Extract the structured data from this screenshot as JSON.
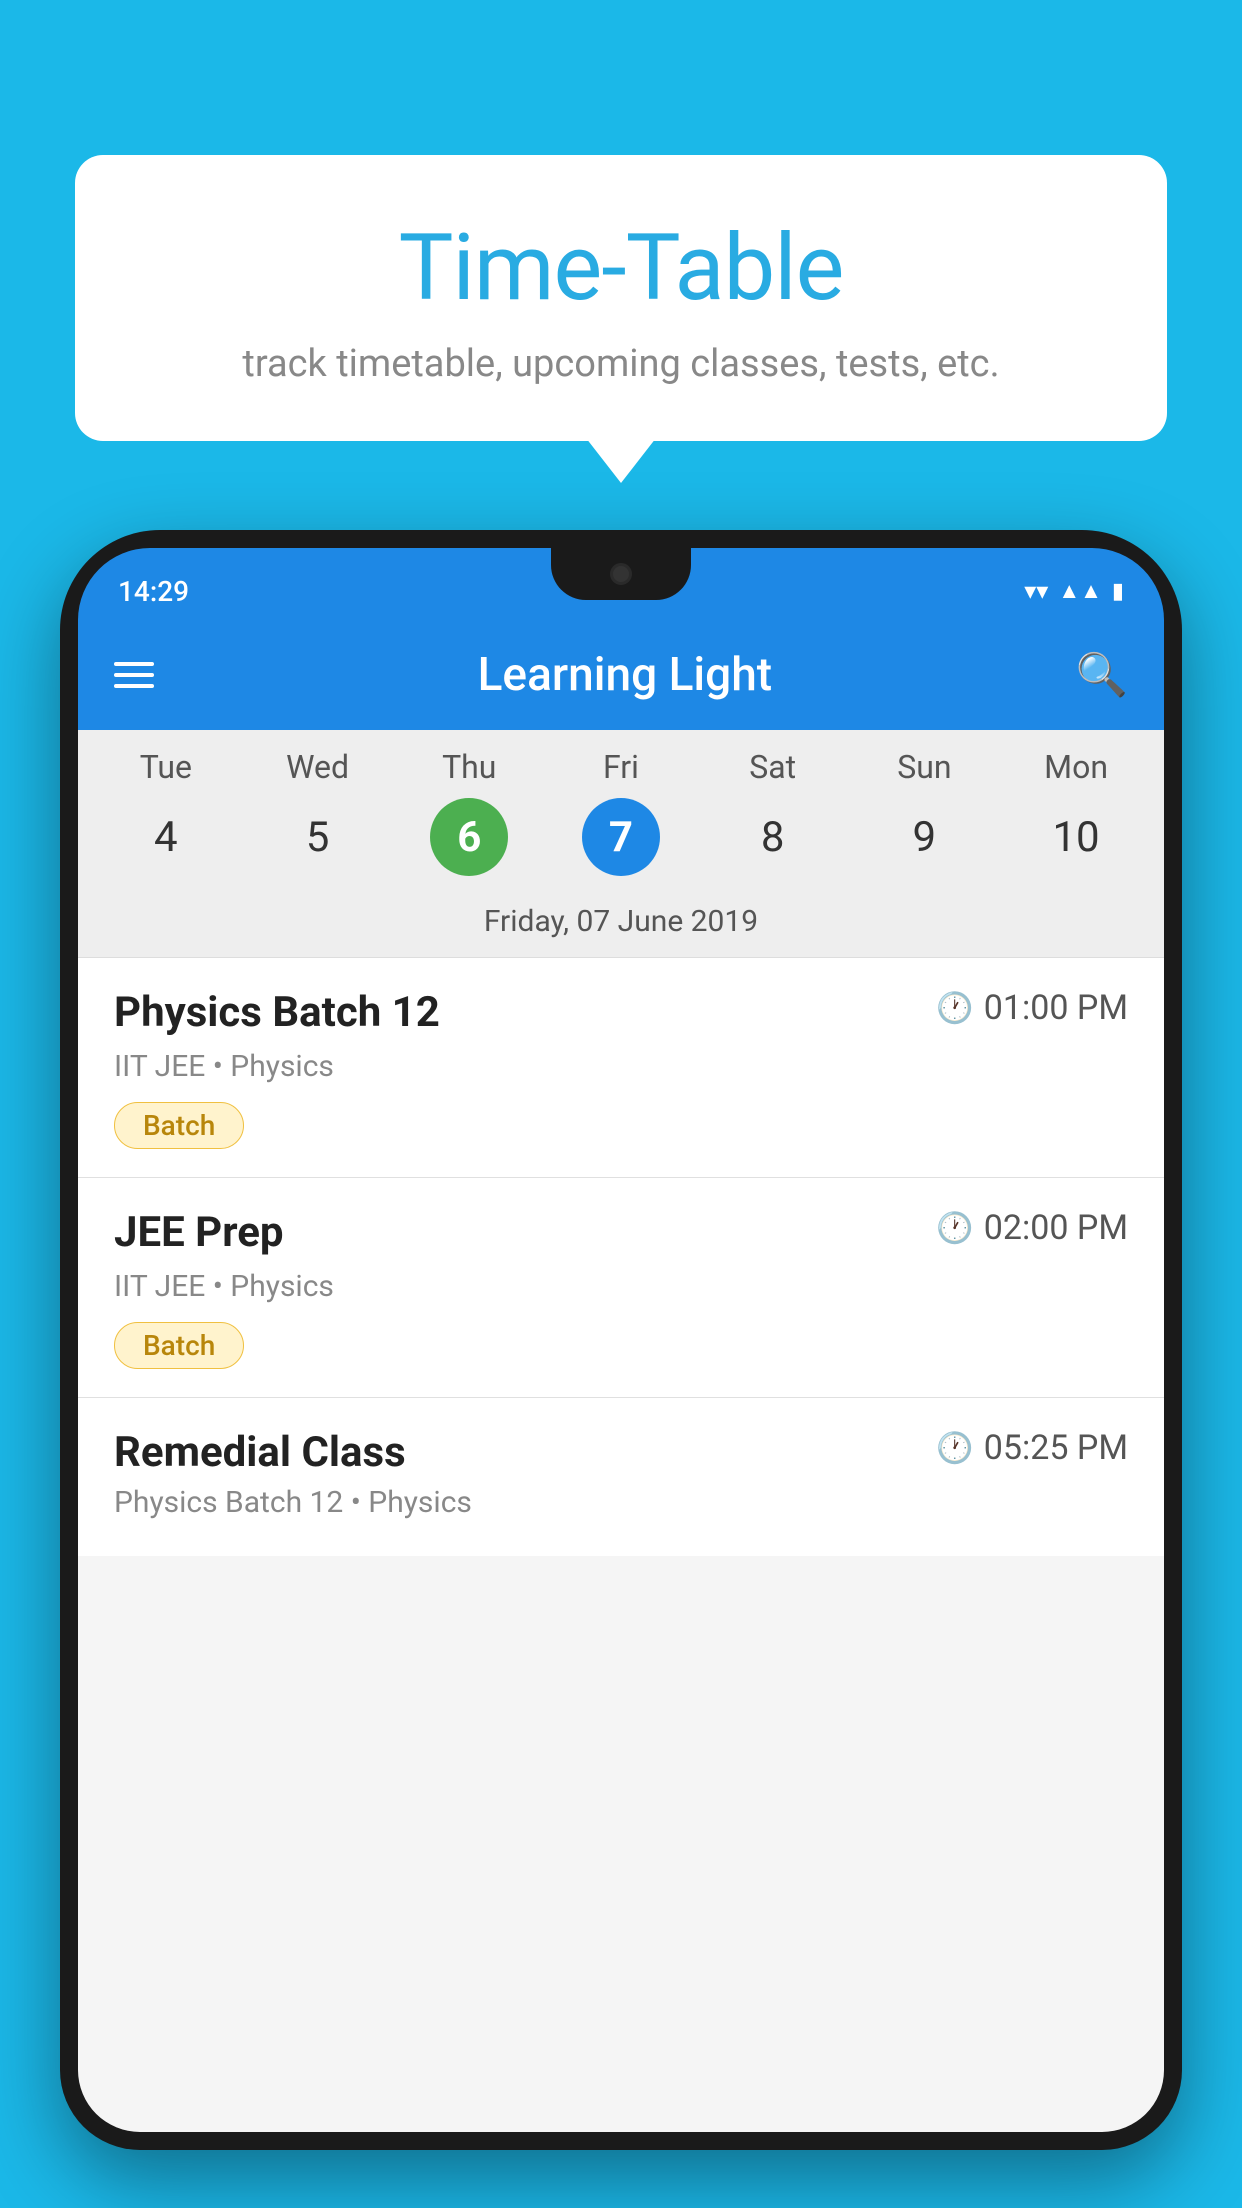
{
  "background_color": "#1BB8E8",
  "speech_bubble": {
    "title": "Time-Table",
    "subtitle": "track timetable, upcoming classes, tests, etc."
  },
  "phone": {
    "status_bar": {
      "time": "14:29"
    },
    "app_header": {
      "title": "Learning Light",
      "search_label": "search"
    },
    "calendar": {
      "selected_date_label": "Friday, 07 June 2019",
      "days": [
        {
          "name": "Tue",
          "num": "4",
          "state": "normal"
        },
        {
          "name": "Wed",
          "num": "5",
          "state": "normal"
        },
        {
          "name": "Thu",
          "num": "6",
          "state": "today"
        },
        {
          "name": "Fri",
          "num": "7",
          "state": "selected"
        },
        {
          "name": "Sat",
          "num": "8",
          "state": "normal"
        },
        {
          "name": "Sun",
          "num": "9",
          "state": "normal"
        },
        {
          "name": "Mon",
          "num": "10",
          "state": "normal"
        }
      ]
    },
    "classes": [
      {
        "name": "Physics Batch 12",
        "time": "01:00 PM",
        "subtitle": "IIT JEE • Physics",
        "badge": "Batch"
      },
      {
        "name": "JEE Prep",
        "time": "02:00 PM",
        "subtitle": "IIT JEE • Physics",
        "badge": "Batch"
      },
      {
        "name": "Remedial Class",
        "time": "05:25 PM",
        "subtitle": "Physics Batch 12 • Physics",
        "badge": null
      }
    ]
  }
}
